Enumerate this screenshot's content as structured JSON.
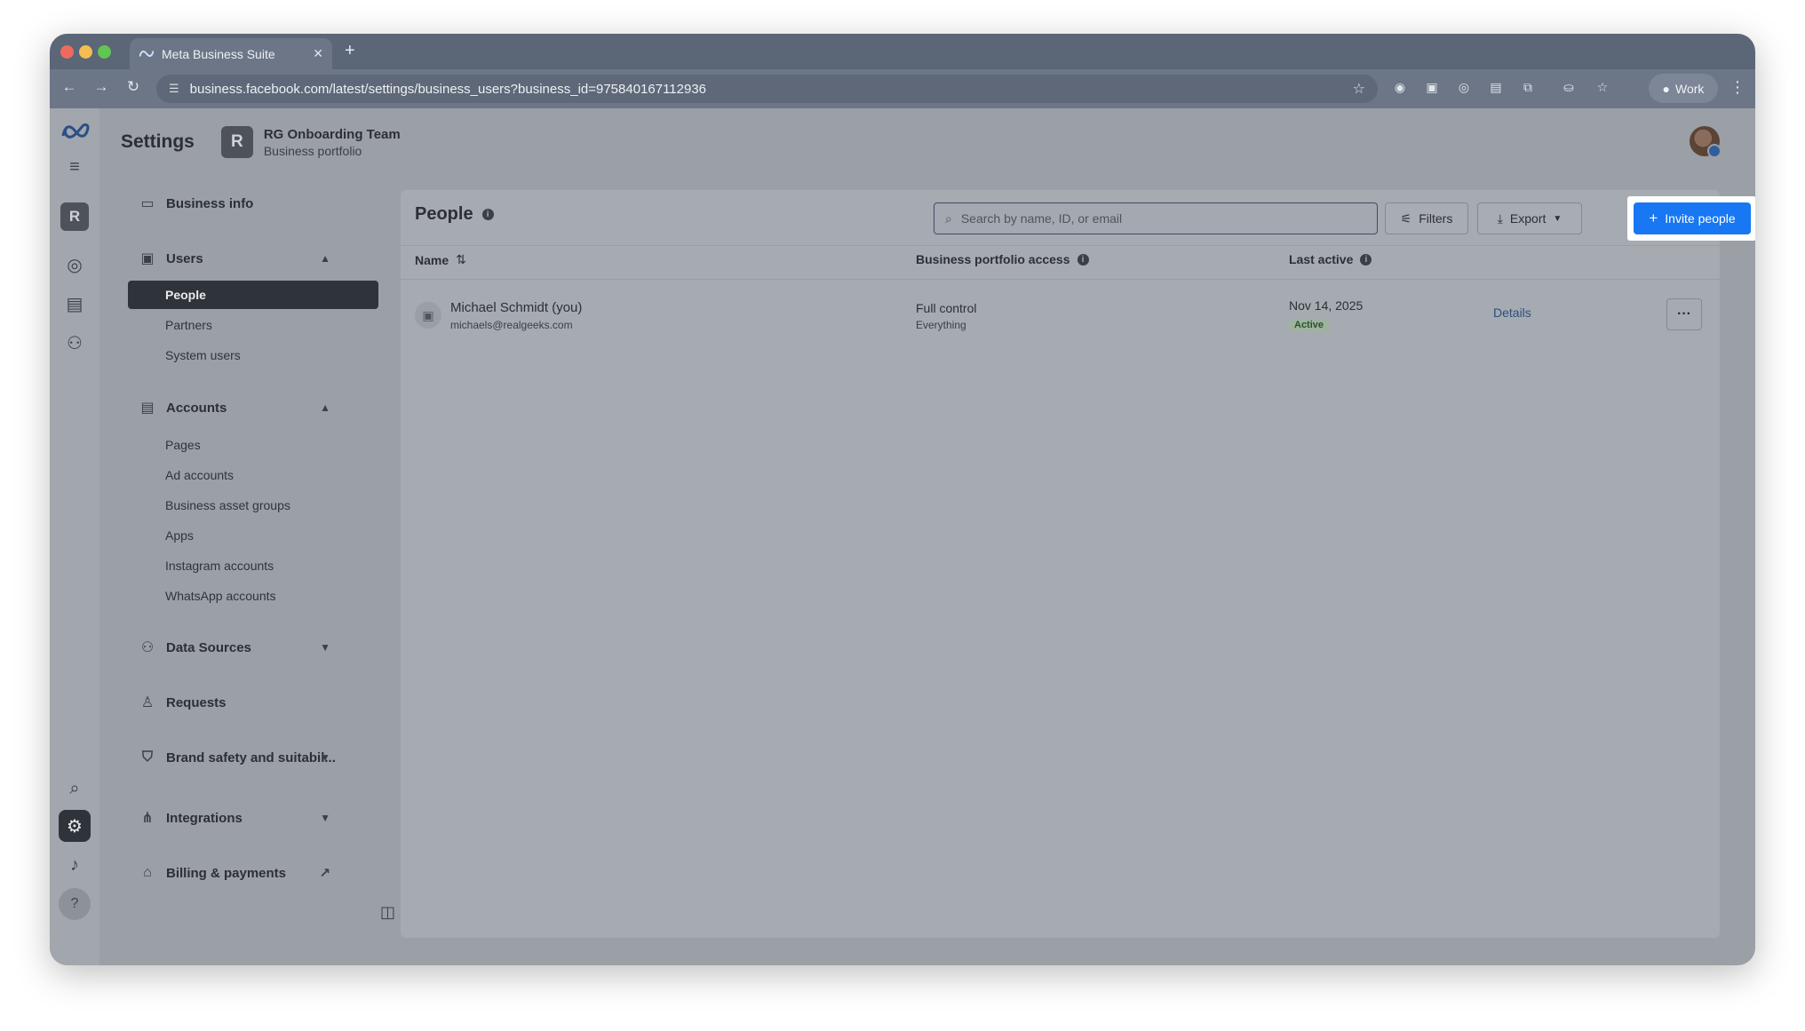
{
  "browser": {
    "tab_title": "Meta Business Suite",
    "url": "business.facebook.com/latest/settings/business_users?business_id=975840167112936",
    "profile_label": "Work",
    "colors": {
      "close": "#ff5f57",
      "minimize": "#febc2e",
      "maximize": "#28c840"
    }
  },
  "rail": {
    "business_initial": "R"
  },
  "header": {
    "title": "Settings",
    "business_initial": "R",
    "business_name": "RG Onboarding Team",
    "business_subtitle": "Business portfolio"
  },
  "sidebar": {
    "business_info": "Business info",
    "users": {
      "label": "Users",
      "items": [
        "People",
        "Partners",
        "System users"
      ]
    },
    "accounts": {
      "label": "Accounts",
      "items": [
        "Pages",
        "Ad accounts",
        "Business asset groups",
        "Apps",
        "Instagram accounts",
        "WhatsApp accounts"
      ]
    },
    "data_sources": "Data Sources",
    "requests": "Requests",
    "brand_safety": "Brand safety and suitabil...",
    "integrations": "Integrations",
    "billing": "Billing & payments"
  },
  "people": {
    "title": "People",
    "search_placeholder": "Search by name, ID, or email",
    "filters_label": "Filters",
    "export_label": "Export",
    "invite_label": "Invite people",
    "columns": {
      "name": "Name",
      "access": "Business portfolio access",
      "last_active": "Last active"
    },
    "rows": [
      {
        "name": "Michael Schmidt (you)",
        "email": "michaels@realgeeks.com",
        "access": "Full control",
        "access_detail": "Everything",
        "last_active": "Nov 14, 2025",
        "status": "Active",
        "details": "Details"
      }
    ],
    "accent_color": "#1877f2"
  }
}
